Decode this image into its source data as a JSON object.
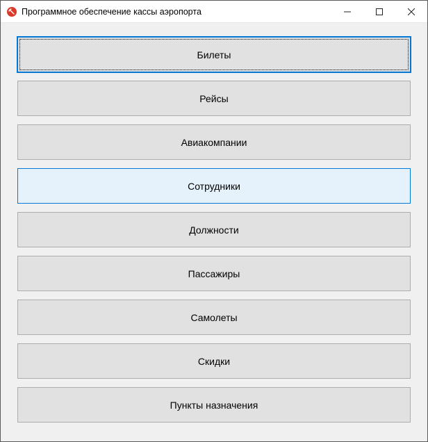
{
  "window": {
    "title": "Программное обеспечение кассы аэропорта"
  },
  "menu": {
    "items": [
      {
        "label": "Билеты",
        "state": "focused"
      },
      {
        "label": "Рейсы",
        "state": "normal"
      },
      {
        "label": "Авиакомпании",
        "state": "normal"
      },
      {
        "label": "Сотрудники",
        "state": "hover"
      },
      {
        "label": "Должности",
        "state": "normal"
      },
      {
        "label": "Пассажиры",
        "state": "normal"
      },
      {
        "label": "Самолеты",
        "state": "normal"
      },
      {
        "label": "Скидки",
        "state": "normal"
      },
      {
        "label": "Пункты назначения",
        "state": "normal"
      }
    ]
  }
}
